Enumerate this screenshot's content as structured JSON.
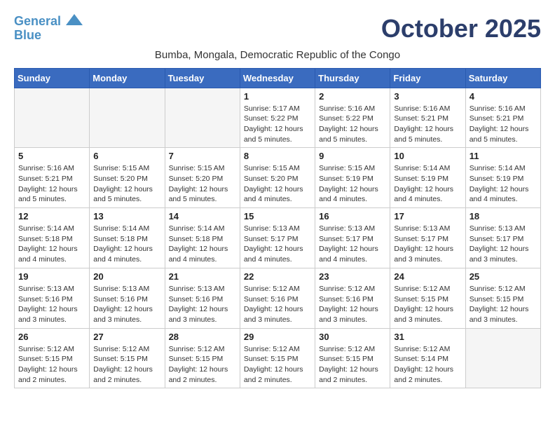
{
  "header": {
    "logo_line1": "General",
    "logo_line2": "Blue",
    "month_title": "October 2025",
    "subtitle": "Bumba, Mongala, Democratic Republic of the Congo"
  },
  "weekdays": [
    "Sunday",
    "Monday",
    "Tuesday",
    "Wednesday",
    "Thursday",
    "Friday",
    "Saturday"
  ],
  "weeks": [
    [
      {
        "day": "",
        "info": ""
      },
      {
        "day": "",
        "info": ""
      },
      {
        "day": "",
        "info": ""
      },
      {
        "day": "1",
        "info": "Sunrise: 5:17 AM\nSunset: 5:22 PM\nDaylight: 12 hours and 5 minutes."
      },
      {
        "day": "2",
        "info": "Sunrise: 5:16 AM\nSunset: 5:22 PM\nDaylight: 12 hours and 5 minutes."
      },
      {
        "day": "3",
        "info": "Sunrise: 5:16 AM\nSunset: 5:21 PM\nDaylight: 12 hours and 5 minutes."
      },
      {
        "day": "4",
        "info": "Sunrise: 5:16 AM\nSunset: 5:21 PM\nDaylight: 12 hours and 5 minutes."
      }
    ],
    [
      {
        "day": "5",
        "info": "Sunrise: 5:16 AM\nSunset: 5:21 PM\nDaylight: 12 hours and 5 minutes."
      },
      {
        "day": "6",
        "info": "Sunrise: 5:15 AM\nSunset: 5:20 PM\nDaylight: 12 hours and 5 minutes."
      },
      {
        "day": "7",
        "info": "Sunrise: 5:15 AM\nSunset: 5:20 PM\nDaylight: 12 hours and 5 minutes."
      },
      {
        "day": "8",
        "info": "Sunrise: 5:15 AM\nSunset: 5:20 PM\nDaylight: 12 hours and 4 minutes."
      },
      {
        "day": "9",
        "info": "Sunrise: 5:15 AM\nSunset: 5:19 PM\nDaylight: 12 hours and 4 minutes."
      },
      {
        "day": "10",
        "info": "Sunrise: 5:14 AM\nSunset: 5:19 PM\nDaylight: 12 hours and 4 minutes."
      },
      {
        "day": "11",
        "info": "Sunrise: 5:14 AM\nSunset: 5:19 PM\nDaylight: 12 hours and 4 minutes."
      }
    ],
    [
      {
        "day": "12",
        "info": "Sunrise: 5:14 AM\nSunset: 5:18 PM\nDaylight: 12 hours and 4 minutes."
      },
      {
        "day": "13",
        "info": "Sunrise: 5:14 AM\nSunset: 5:18 PM\nDaylight: 12 hours and 4 minutes."
      },
      {
        "day": "14",
        "info": "Sunrise: 5:14 AM\nSunset: 5:18 PM\nDaylight: 12 hours and 4 minutes."
      },
      {
        "day": "15",
        "info": "Sunrise: 5:13 AM\nSunset: 5:17 PM\nDaylight: 12 hours and 4 minutes."
      },
      {
        "day": "16",
        "info": "Sunrise: 5:13 AM\nSunset: 5:17 PM\nDaylight: 12 hours and 4 minutes."
      },
      {
        "day": "17",
        "info": "Sunrise: 5:13 AM\nSunset: 5:17 PM\nDaylight: 12 hours and 3 minutes."
      },
      {
        "day": "18",
        "info": "Sunrise: 5:13 AM\nSunset: 5:17 PM\nDaylight: 12 hours and 3 minutes."
      }
    ],
    [
      {
        "day": "19",
        "info": "Sunrise: 5:13 AM\nSunset: 5:16 PM\nDaylight: 12 hours and 3 minutes."
      },
      {
        "day": "20",
        "info": "Sunrise: 5:13 AM\nSunset: 5:16 PM\nDaylight: 12 hours and 3 minutes."
      },
      {
        "day": "21",
        "info": "Sunrise: 5:13 AM\nSunset: 5:16 PM\nDaylight: 12 hours and 3 minutes."
      },
      {
        "day": "22",
        "info": "Sunrise: 5:12 AM\nSunset: 5:16 PM\nDaylight: 12 hours and 3 minutes."
      },
      {
        "day": "23",
        "info": "Sunrise: 5:12 AM\nSunset: 5:16 PM\nDaylight: 12 hours and 3 minutes."
      },
      {
        "day": "24",
        "info": "Sunrise: 5:12 AM\nSunset: 5:15 PM\nDaylight: 12 hours and 3 minutes."
      },
      {
        "day": "25",
        "info": "Sunrise: 5:12 AM\nSunset: 5:15 PM\nDaylight: 12 hours and 3 minutes."
      }
    ],
    [
      {
        "day": "26",
        "info": "Sunrise: 5:12 AM\nSunset: 5:15 PM\nDaylight: 12 hours and 2 minutes."
      },
      {
        "day": "27",
        "info": "Sunrise: 5:12 AM\nSunset: 5:15 PM\nDaylight: 12 hours and 2 minutes."
      },
      {
        "day": "28",
        "info": "Sunrise: 5:12 AM\nSunset: 5:15 PM\nDaylight: 12 hours and 2 minutes."
      },
      {
        "day": "29",
        "info": "Sunrise: 5:12 AM\nSunset: 5:15 PM\nDaylight: 12 hours and 2 minutes."
      },
      {
        "day": "30",
        "info": "Sunrise: 5:12 AM\nSunset: 5:15 PM\nDaylight: 12 hours and 2 minutes."
      },
      {
        "day": "31",
        "info": "Sunrise: 5:12 AM\nSunset: 5:14 PM\nDaylight: 12 hours and 2 minutes."
      },
      {
        "day": "",
        "info": ""
      }
    ]
  ]
}
